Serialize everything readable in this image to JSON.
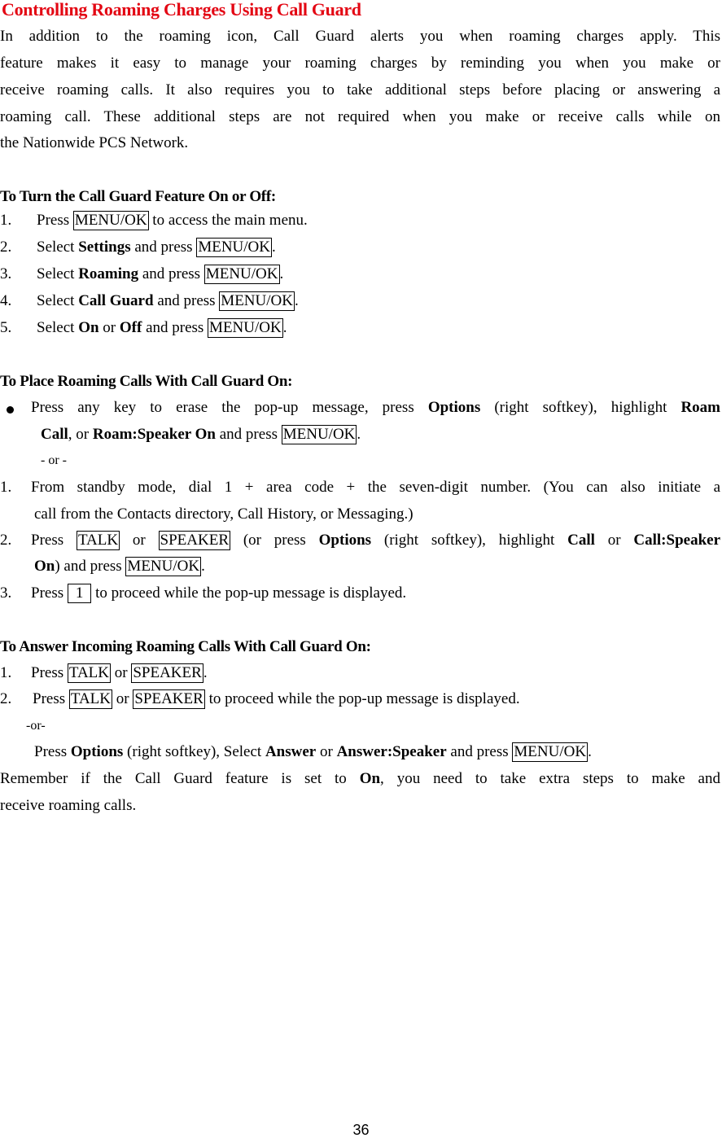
{
  "title": "Controlling Roaming Charges Using Call Guard",
  "intro": [
    "In addition to the roaming icon, Call Guard alerts you when roaming charges apply. This",
    "feature makes it easy to manage your roaming charges by reminding you when you make or",
    "receive roaming calls. It also requires you to take additional steps before placing or answering a",
    "roaming call. These additional steps are not required when you make or receive calls while on",
    "the Nationwide PCS Network."
  ],
  "section1": {
    "heading": "To Turn the Call Guard Feature On or Off:",
    "steps": [
      {
        "num": "1.",
        "pre": "Press ",
        "key": "MENU/OK",
        "post": " to access the main menu."
      },
      {
        "num": "2.",
        "pre": "Select ",
        "bold": "Settings",
        "mid": " and press ",
        "key": "MENU/OK",
        "post": "."
      },
      {
        "num": "3.",
        "pre": "Select ",
        "bold": "Roaming",
        "mid": " and press ",
        "key": "MENU/OK",
        "post": "."
      },
      {
        "num": "4.",
        "pre": "Select ",
        "bold": "Call Guard",
        "mid": " and press ",
        "key": "MENU/OK",
        "post": "."
      },
      {
        "num": "5.",
        "pre": "Select ",
        "bold": "On",
        "or": " or ",
        "bold2": "Off",
        "mid": " and press ",
        "key": "MENU/OK",
        "post": "."
      }
    ]
  },
  "section2": {
    "heading": "To Place Roaming Calls With Call Guard On:",
    "bullet": {
      "t1": "Press any key to erase the pop-up message, press ",
      "b1": "Options",
      "t2": " (right softkey), highlight ",
      "b2": "Roam",
      "b3": "Call",
      "t3": ", or ",
      "b4": "Roam:Speaker On",
      "t4": " and press ",
      "key": "MENU/OK",
      "t5": "."
    },
    "or": "- or -",
    "step1": {
      "num": "1.",
      "line1": "From standby mode, dial 1 + area code + the seven-digit number. (You can also initiate a",
      "line2": "call from the Contacts directory, Call History, or Messaging.)"
    },
    "step2": {
      "num": "2.",
      "t1": "Press ",
      "k1": "TALK",
      "t2": " or ",
      "k2": "SPEAKER",
      "t3": " (or press ",
      "b1": "Options",
      "t4": " (right softkey), highlight ",
      "b2": "Call",
      "t5": " or ",
      "b3": "Call:Speaker",
      "b4": "On",
      "t6": ") and press ",
      "k3": "MENU/OK",
      "t7": "."
    },
    "step3": {
      "num": "3.",
      "t1": "Press ",
      "key": "1",
      "t2": " to proceed while the pop-up message is displayed."
    }
  },
  "section3": {
    "heading": "To Answer Incoming Roaming Calls With Call Guard On:",
    "step1": {
      "num": "1.",
      "t1": "Press ",
      "k1": "TALK",
      "t2": " or ",
      "k2": "SPEAKER",
      "t3": "."
    },
    "step2": {
      "num": "2.",
      "t1": "Press ",
      "k1": "TALK",
      "t2": " or ",
      "k2": "SPEAKER",
      "t3": " to proceed while the pop-up message is displayed."
    },
    "or": "-or-",
    "alt": {
      "t1": "Press ",
      "b1": "Options",
      "t2": " (right softkey), Select ",
      "b2": "Answer",
      "t3": " or ",
      "b3": "Answer:Speaker",
      "t4": " and press ",
      "key": "MENU/OK",
      "t5": "."
    },
    "remember": {
      "t1": "Remember if the Call Guard feature is set to ",
      "b1": "On",
      "t2": ", you need to take extra steps to make and",
      "line2": "receive roaming calls."
    }
  },
  "footer": {
    "page_number": "36"
  }
}
